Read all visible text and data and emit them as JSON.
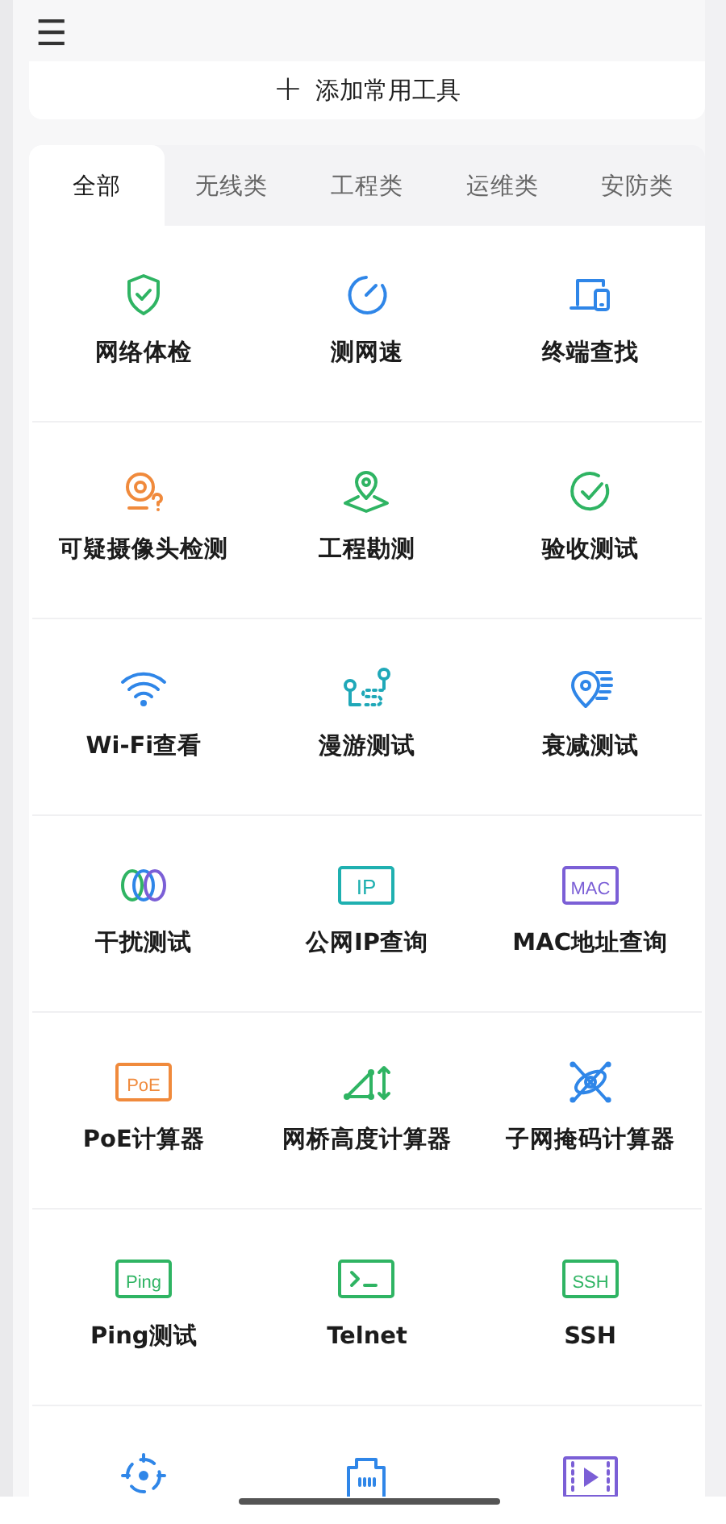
{
  "header": {
    "menu_icon": "☰"
  },
  "add_tools": {
    "icon": "+",
    "label": "添加常用工具"
  },
  "tabs": [
    {
      "label": "全部",
      "selected": true
    },
    {
      "label": "无线类",
      "selected": false
    },
    {
      "label": "工程类",
      "selected": false
    },
    {
      "label": "运维类",
      "selected": false
    },
    {
      "label": "安防类",
      "selected": false
    }
  ],
  "tools": [
    {
      "label": "网络体检",
      "kind": "shield",
      "color": "#2fb463"
    },
    {
      "label": "测网速",
      "kind": "gauge",
      "color": "#2f86e8"
    },
    {
      "label": "终端查找",
      "kind": "devices",
      "color": "#2f86e8"
    },
    {
      "label": "可疑摄像头检测",
      "kind": "camera",
      "color": "#f08a3c"
    },
    {
      "label": "工程勘测",
      "kind": "map-pin",
      "color": "#2fb463"
    },
    {
      "label": "验收测试",
      "kind": "check-circle",
      "color": "#2fb463"
    },
    {
      "label": "Wi-Fi查看",
      "kind": "wifi",
      "color": "#2f86e8"
    },
    {
      "label": "漫游测试",
      "kind": "roaming",
      "color": "#1fa8b8"
    },
    {
      "label": "衰减测试",
      "kind": "attenuation",
      "color": "#2f86e8"
    },
    {
      "label": "干扰测试",
      "kind": "rings",
      "color": "#2f86e8"
    },
    {
      "label": "公网IP查询",
      "kind": "text-box",
      "icon_text": "IP",
      "color": "#1fb0b0"
    },
    {
      "label": "MAC地址查询",
      "kind": "text-box",
      "icon_text": "MAC",
      "color": "#7b5fd6"
    },
    {
      "label": "PoE计算器",
      "kind": "text-box",
      "icon_text": "PoE",
      "color": "#f08a3c"
    },
    {
      "label": "网桥高度计算器",
      "kind": "triangle",
      "color": "#2fb463"
    },
    {
      "label": "子网掩码计算器",
      "kind": "subnet",
      "color": "#2f86e8"
    },
    {
      "label": "Ping测试",
      "kind": "text-box",
      "icon_text": "Ping",
      "color": "#2fb463"
    },
    {
      "label": "Telnet",
      "kind": "terminal",
      "color": "#2fb463"
    },
    {
      "label": "SSH",
      "kind": "text-box",
      "icon_text": "SSH",
      "color": "#2fb463"
    },
    {
      "kind": "crosshair",
      "color": "#2f86e8"
    },
    {
      "kind": "ethernet",
      "color": "#2f86e8"
    },
    {
      "kind": "video",
      "color": "#7b5fd6"
    }
  ]
}
